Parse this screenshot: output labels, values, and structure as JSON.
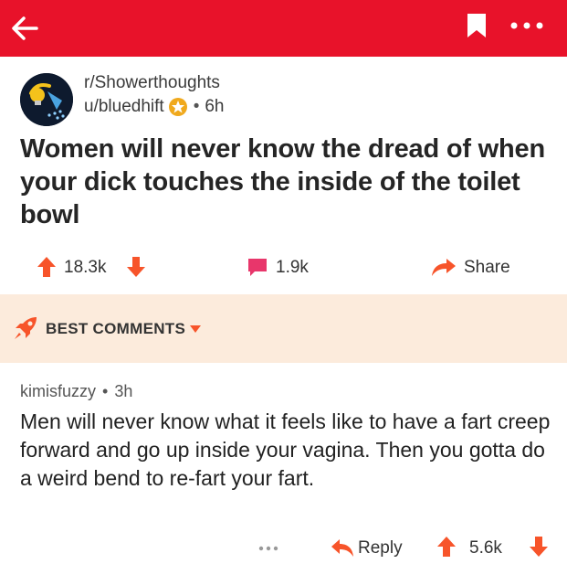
{
  "colors": {
    "brand_red": "#e8122a",
    "upvote_orange": "#f7542a",
    "comment_pink": "#e8366b",
    "best_comments_bg": "#fcebdc"
  },
  "topbar": {
    "back_icon": "arrow-left-icon",
    "bookmark_icon": "bookmark-icon",
    "more_icon": "more-horizontal-icon"
  },
  "post": {
    "subreddit": "r/Showerthoughts",
    "username": "u/bluedhift",
    "award_icon": "gold-award-icon",
    "age": "6h",
    "title": "Women will never know the dread of when your dick touches the inside of the toilet bowl",
    "score": "18.3k",
    "comments": "1.9k",
    "share_label": "Share"
  },
  "sort": {
    "label": "BEST COMMENTS",
    "icon": "rocket-icon"
  },
  "comment": {
    "author": "kimisfuzzy",
    "age": "3h",
    "body": "Men will never know what it feels like to have a fart creep forward and go up inside your vagina. Then you gotta do a weird bend to re-fart your fart.",
    "more_label": "...",
    "reply_label": "Reply",
    "score": "5.6k"
  }
}
